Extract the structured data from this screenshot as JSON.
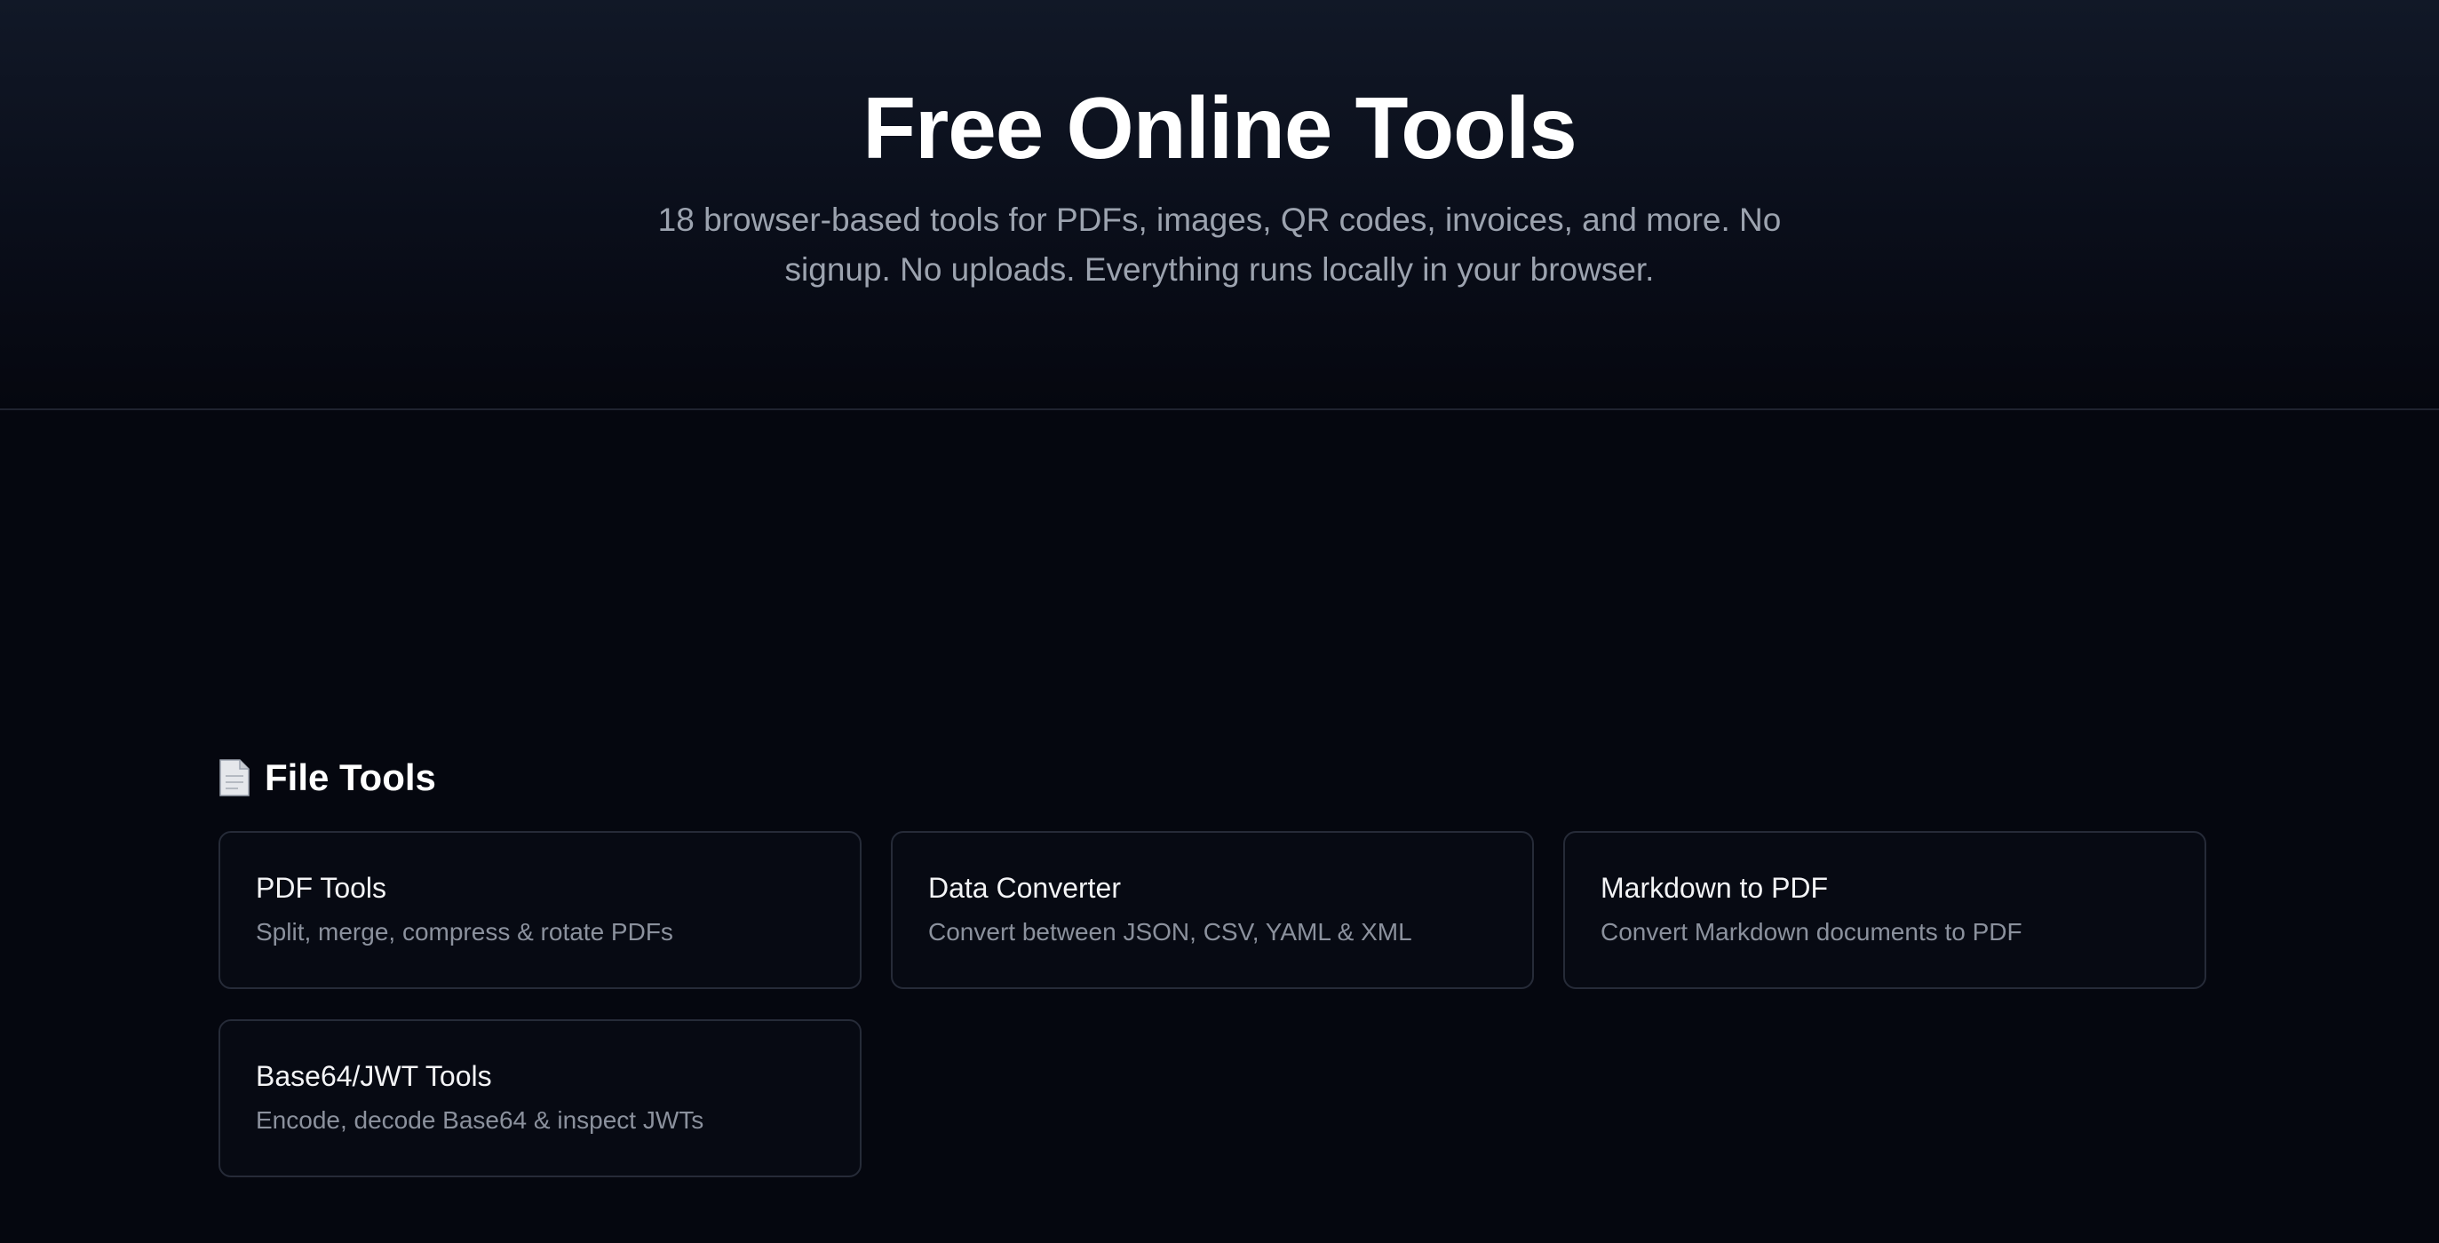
{
  "hero": {
    "title": "Free Online Tools",
    "subtitle": "18 browser-based tools for PDFs, images, QR codes, invoices, and more. No signup. No uploads. Everything runs locally in your browser."
  },
  "section": {
    "icon": "document-icon",
    "title": "File Tools",
    "cards": [
      {
        "title": "PDF Tools",
        "description": "Split, merge, compress & rotate PDFs"
      },
      {
        "title": "Data Converter",
        "description": "Convert between JSON, CSV, YAML & XML"
      },
      {
        "title": "Markdown to PDF",
        "description": "Convert Markdown documents to PDF"
      },
      {
        "title": "Base64/JWT Tools",
        "description": "Encode, decode Base64 & inspect JWTs"
      }
    ]
  },
  "colors": {
    "background": "#05070f",
    "hero_top": "#111827",
    "card_border": "#262b38",
    "muted_text": "#9ca3af"
  }
}
